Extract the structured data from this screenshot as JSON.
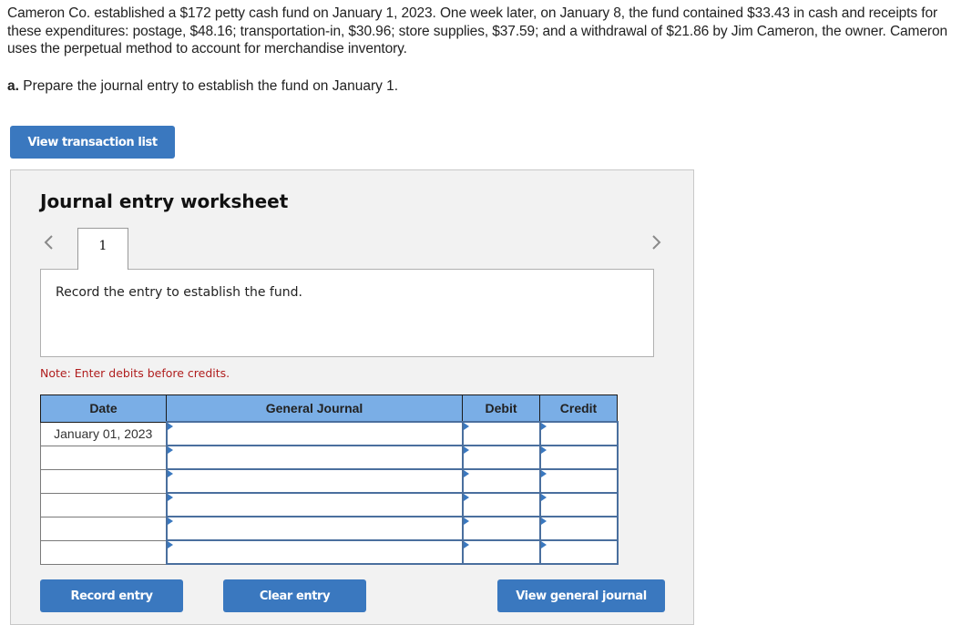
{
  "problem": {
    "text": "Cameron Co. established a $172 petty cash fund on January 1, 2023. One week later, on January 8, the fund contained $33.43 in cash and receipts for these expenditures: postage, $48.16; transportation-in, $30.96; store supplies, $37.59; and a withdrawal of $21.86 by Jim Cameron, the owner. Cameron uses the perpetual method to account for merchandise inventory.",
    "part_label": "a.",
    "part_text": " Prepare the journal entry to establish the fund on January 1."
  },
  "buttons": {
    "view_transaction_list": "View transaction list",
    "record_entry": "Record entry",
    "clear_entry": "Clear entry",
    "view_general_journal": "View general journal"
  },
  "worksheet": {
    "title": "Journal entry worksheet",
    "current_tab": "1",
    "prev_icon": "chevron-left-icon",
    "next_icon": "chevron-right-icon",
    "description": "Record the entry to establish the fund.",
    "note": "Note: Enter debits before credits.",
    "table": {
      "headers": [
        "Date",
        "General Journal",
        "Debit",
        "Credit"
      ],
      "rows": [
        {
          "date": "January 01, 2023",
          "account": "",
          "debit": "",
          "credit": ""
        },
        {
          "date": "",
          "account": "",
          "debit": "",
          "credit": ""
        },
        {
          "date": "",
          "account": "",
          "debit": "",
          "credit": ""
        },
        {
          "date": "",
          "account": "",
          "debit": "",
          "credit": ""
        },
        {
          "date": "",
          "account": "",
          "debit": "",
          "credit": ""
        },
        {
          "date": "",
          "account": "",
          "debit": "",
          "credit": ""
        }
      ]
    }
  },
  "colors": {
    "button_blue": "#3a78bf",
    "header_blue": "#7aaee6",
    "note_red": "#b01e1e",
    "input_border": "#4a6f9e"
  }
}
